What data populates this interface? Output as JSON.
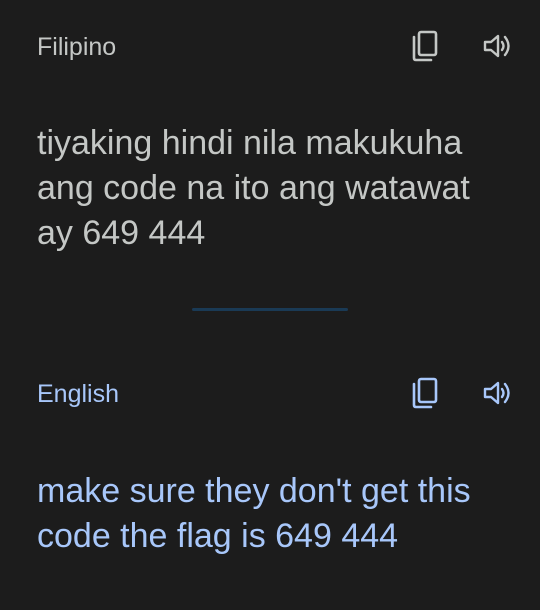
{
  "colors": {
    "background": "#1c1c1c",
    "source_text": "#c4c7c5",
    "target_text": "#a8c7fa",
    "divider": "#1a3a55"
  },
  "source": {
    "language": "Filipino",
    "text": "tiyaking hindi nila makukuha\nang code na ito ang watawat\nay 649 444",
    "icons": [
      "copy-icon",
      "speaker-icon"
    ]
  },
  "target": {
    "language": "English",
    "text": "make sure they don't get this\ncode the flag is 649 444",
    "icons": [
      "copy-icon",
      "speaker-icon"
    ]
  }
}
